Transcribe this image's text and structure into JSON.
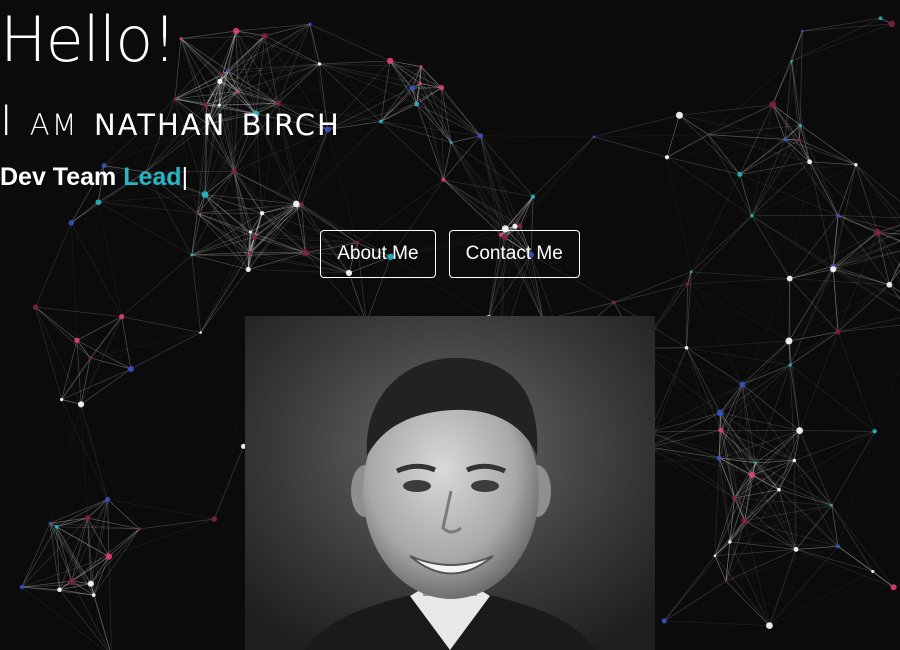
{
  "hero": {
    "greeting": "Hello!",
    "intro_prefix": "I am",
    "name": "nathan birch",
    "role_prefix": "Dev Team",
    "role_highlight": "Lead",
    "cursor": "|"
  },
  "buttons": {
    "about_label": "About Me",
    "contact_label": "Contact Me"
  },
  "colors": {
    "background": "#0b0b0b",
    "accent": "#26b5c4",
    "text": "#ffffff"
  },
  "portrait": {
    "alt": "Nathan Birch headshot"
  }
}
